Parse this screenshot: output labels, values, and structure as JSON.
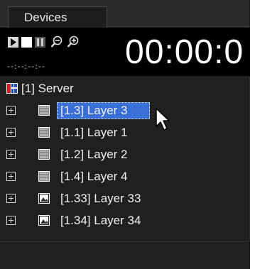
{
  "tab": {
    "label": "Devices"
  },
  "transport": {
    "counter_small": "--:--:--:--",
    "timecode": "00:00:0"
  },
  "tree": {
    "server": {
      "label": "[1] Server"
    },
    "layers": [
      {
        "label": "[1.3] Layer 3",
        "icon": "layer-pattern-icon",
        "selected": true
      },
      {
        "label": "[1.1] Layer 1",
        "icon": "layer-pattern-icon",
        "selected": false
      },
      {
        "label": "[1.2] Layer 2",
        "icon": "layer-pattern-icon",
        "selected": false
      },
      {
        "label": "[1.4] Layer 4",
        "icon": "layer-pattern-icon",
        "selected": false
      },
      {
        "label": "[1.33] Layer 33",
        "icon": "layer-image-icon",
        "selected": false
      },
      {
        "label": "[1.34] Layer 34",
        "icon": "layer-image-icon",
        "selected": false
      }
    ]
  },
  "colors": {
    "panel_bg": "#202020",
    "selection": "#3a6fd8",
    "text": "#f0f0f0"
  }
}
